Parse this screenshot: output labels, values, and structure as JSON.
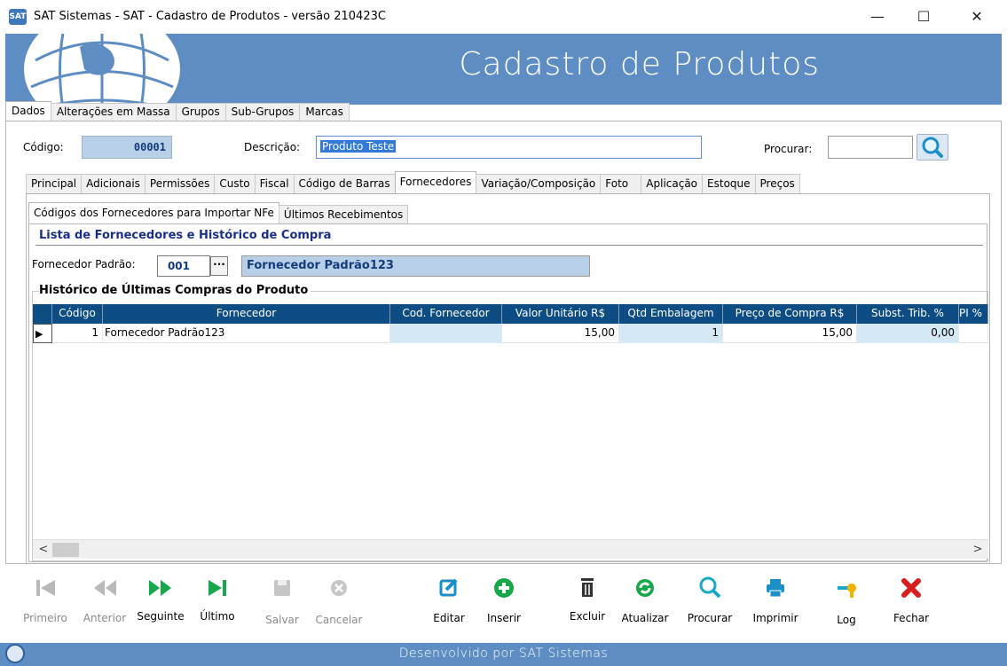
{
  "window": {
    "icon_text": "SAT",
    "title": "SAT Sistemas - SAT - Cadastro de Produtos - versão 210423C",
    "minimize": "—",
    "maximize": "☐",
    "close": "✕"
  },
  "banner": {
    "title": "Cadastro de Produtos"
  },
  "main_tabs": [
    "Dados",
    "Alterações em Massa",
    "Grupos",
    "Sub-Grupos",
    "Marcas"
  ],
  "form": {
    "codigo_label": "Código:",
    "codigo_value": "00001",
    "descricao_label": "Descrição:",
    "descricao_value": "Produto Teste",
    "procurar_label": "Procurar:",
    "procurar_value": ""
  },
  "sub_tabs": [
    "Principal",
    "Adicionais",
    "Permissões",
    "Custo",
    "Fiscal",
    "Código de Barras",
    "Fornecedores",
    "Variação/Composição",
    "Foto",
    "Aplicação",
    "Estoque",
    "Preços"
  ],
  "inner_tabs": [
    "Códigos dos Fornecedores para Importar NFe",
    "Últimos Recebimentos"
  ],
  "section1": "Lista de Fornecedores e Histórico de Compra",
  "fornecedor_padrao": {
    "label": "Fornecedor Padrão:",
    "code": "001",
    "lookup": "···",
    "name": "Fornecedor Padrão123"
  },
  "section2": "Histórico de Últimas Compras do Produto",
  "grid": {
    "headers": [
      "Código",
      "Fornecedor",
      "Cod. Fornecedor",
      "Valor Unitário R$",
      "Qtd Embalagem",
      "Preço de Compra R$",
      "Subst. Trib. %",
      "PI %"
    ],
    "row_indicator": "▶",
    "rows": [
      [
        "1",
        "Fornecedor Padrão123",
        "",
        "15,00",
        "1",
        "15,00",
        "0,00",
        ""
      ]
    ]
  },
  "scroll": {
    "left": "<",
    "right": ">"
  },
  "toolbar": [
    {
      "label": "Primeiro",
      "icon": "first-icon",
      "enabled": false
    },
    {
      "label": "Anterior",
      "icon": "previous-icon",
      "enabled": false
    },
    {
      "label": "Seguinte",
      "icon": "next-icon",
      "enabled": true
    },
    {
      "label": "Último",
      "icon": "last-icon",
      "enabled": true
    },
    {
      "label": "Salvar",
      "icon": "save-icon",
      "enabled": false
    },
    {
      "label": "Cancelar",
      "icon": "cancel-icon",
      "enabled": false
    },
    {
      "label": "Editar",
      "icon": "edit-icon",
      "enabled": true
    },
    {
      "label": "Inserir",
      "icon": "insert-icon",
      "enabled": true
    },
    {
      "label": "Excluir",
      "icon": "delete-icon",
      "enabled": true
    },
    {
      "label": "Atualizar",
      "icon": "refresh-icon",
      "enabled": true
    },
    {
      "label": "Procurar",
      "icon": "search-icon",
      "enabled": true
    },
    {
      "label": "Imprimir",
      "icon": "print-icon",
      "enabled": true
    },
    {
      "label": "Log",
      "icon": "log-key-icon",
      "enabled": true
    },
    {
      "label": "Fechar",
      "icon": "close-icon",
      "enabled": true
    }
  ],
  "status": {
    "text": "Desenvolvido por SAT Sistemas"
  },
  "colors": {
    "banner": "#5d8dc2",
    "grid_header": "#0e4d84",
    "green": "#16a84a",
    "teal": "#19a8c8",
    "red": "#d61f1f"
  }
}
